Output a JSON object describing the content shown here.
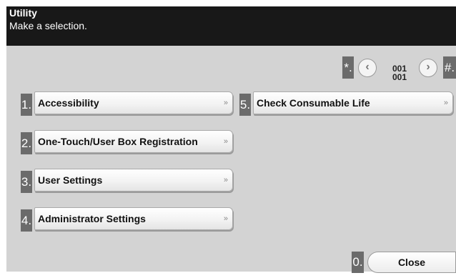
{
  "header": {
    "title": "Utility",
    "subtitle": "Make a selection."
  },
  "nav": {
    "star_label": "*.",
    "prev_icon": "‹",
    "page_current": "001",
    "page_total": "001",
    "next_icon": "›",
    "hash_label": "#."
  },
  "menu": {
    "items": [
      {
        "num": "1.",
        "label": "Accessibility"
      },
      {
        "num": "2.",
        "label": "One-Touch/User Box Registration"
      },
      {
        "num": "3.",
        "label": "User Settings"
      },
      {
        "num": "4.",
        "label": "Administrator Settings"
      },
      {
        "num": "5.",
        "label": "Check Consumable Life"
      }
    ],
    "arrow_glyph": "»"
  },
  "footer": {
    "close_num": "0.",
    "close_label": "Close"
  }
}
